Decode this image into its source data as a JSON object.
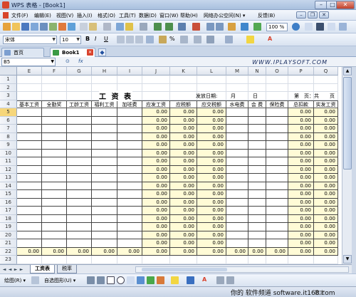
{
  "window": {
    "title": "WPS 表格 - [Book1]"
  },
  "menu": [
    "文件(F)",
    "编辑(E)",
    "视图(V)",
    "插入(I)",
    "格式(O)",
    "工具(T)",
    "数据(D)",
    "窗口(W)",
    "帮助(H)",
    "网络办公空间(N) ▾",
    "反馈(B)"
  ],
  "toolbar": {
    "zoom": "100 %",
    "font": "宋体",
    "size": "10"
  },
  "tabs": {
    "home": "首页",
    "book": "Book1"
  },
  "formula": {
    "cell_ref": "B5",
    "fx": "fx",
    "watermark": "WWW.IPLAYSOFT.COM"
  },
  "columns": [
    "E",
    "F",
    "G",
    "H",
    "I",
    "J",
    "K",
    "L",
    "M",
    "N",
    "O",
    "P",
    "Q"
  ],
  "rows": [
    "1",
    "2",
    "3",
    "4",
    "5",
    "6",
    "7",
    "8",
    "9",
    "10",
    "11",
    "12",
    "13",
    "14",
    "15",
    "16",
    "17",
    "18",
    "19",
    "20",
    "21",
    "22",
    "23",
    "24"
  ],
  "sheet": {
    "title": "工 资 表",
    "date_label": "发放日期:",
    "month": "月",
    "day": "日",
    "page_label": "第",
    "page_mid": "页：共",
    "page_end": "页",
    "headers": [
      "基本工资",
      "全勤奖",
      "工龄工资",
      "福利工资",
      "加班费",
      "应发工资",
      "应税额",
      "应交税额",
      "水电费",
      "会 费",
      "保险费",
      "总扣款",
      "实发工资"
    ],
    "zero": "0.00",
    "data_row_count": 17
  },
  "sheet_tabs": [
    "工资表",
    "税率"
  ],
  "drawbar": {
    "draw": "绘图(R) ▾",
    "shapes": "自选图形(U) ▾"
  },
  "status": {
    "caption": "你的 软件频道 software.it168.com",
    "mode": "数字"
  },
  "colors": {
    "accent": "#d9432d",
    "header_yellow": "#fffbd6",
    "row_select": "#f6d67a"
  }
}
